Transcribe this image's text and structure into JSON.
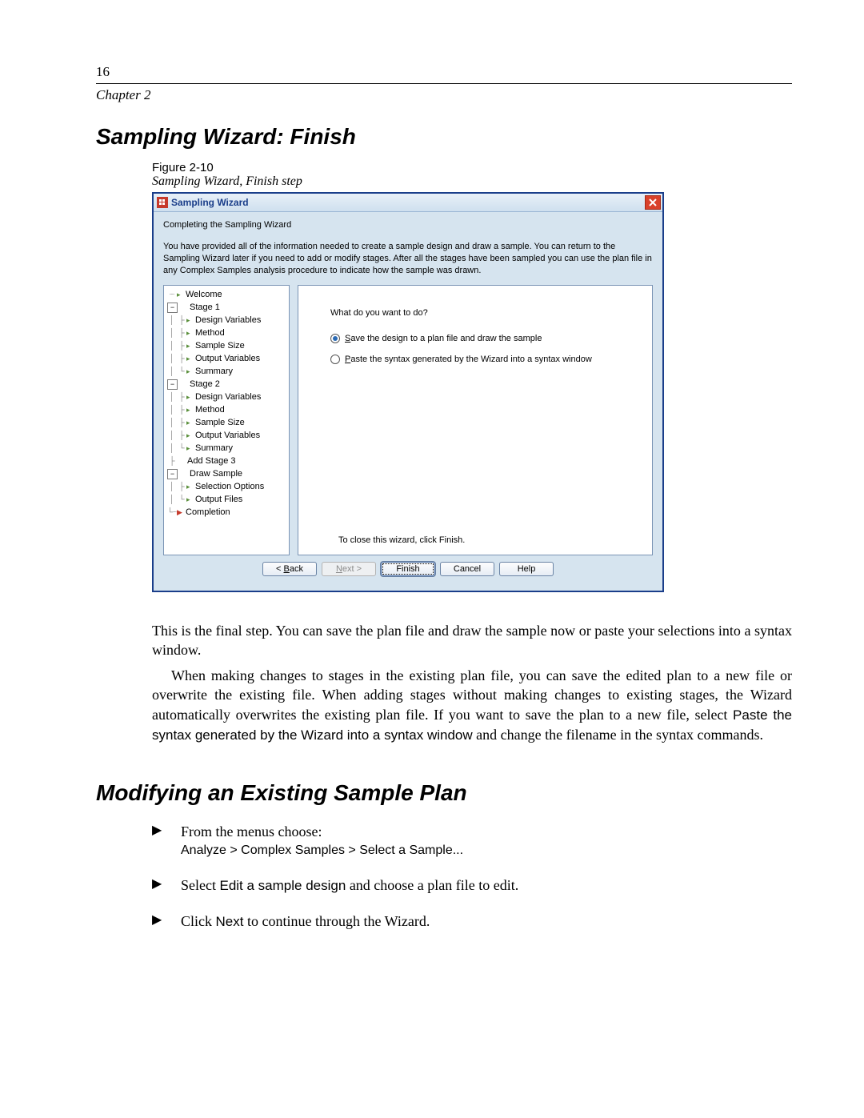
{
  "page": {
    "number": "16",
    "chapter": "Chapter 2"
  },
  "heading1": "Sampling Wizard: Finish",
  "figure": {
    "label": "Figure 2-10",
    "caption": "Sampling Wizard, Finish step"
  },
  "dialog": {
    "title": "Sampling Wizard",
    "subtitle": "Completing the Sampling Wizard",
    "desc": "You have provided all of the information needed to create a sample design and draw a sample.\nYou can return to the Sampling Wizard later if you need to add or modify stages. After all the stages have been sampled you can use the plan file in any Complex Samples analysis procedure to indicate how the sample was drawn.",
    "tree": {
      "welcome": "Welcome",
      "stage1": "Stage 1",
      "stage2": "Stage 2",
      "design_variables": "Design Variables",
      "method": "Method",
      "sample_size": "Sample Size",
      "output_variables": "Output Variables",
      "summary": "Summary",
      "add_stage3": "Add Stage 3",
      "draw_sample": "Draw Sample",
      "selection_options": "Selection Options",
      "output_files": "Output Files",
      "completion": "Completion"
    },
    "question": "What do you want to do?",
    "radio1_pre": "S",
    "radio1_rest": "ave the design to a plan file and draw the sample",
    "radio2_pre": "P",
    "radio2_rest": "aste the syntax generated by the Wizard into a syntax window",
    "footer_text": "To close this wizard, click Finish.",
    "buttons": {
      "back_pre": "< ",
      "back_u": "B",
      "back_rest": "ack",
      "next_u": "N",
      "next_rest": "ext >",
      "finish": "Finish",
      "cancel": "Cancel",
      "help": "Help"
    }
  },
  "para1_a": "This is the final step. You can save the plan file and draw the sample now or paste your selections into a syntax window.",
  "para2_a": "When making changes to stages in the existing plan file, you can save the edited plan to a new file or overwrite the existing file. When adding stages without making changes to existing stages, the Wizard automatically overwrites the existing plan file. If you want to save the plan to a new file, select ",
  "para2_sans": "Paste the syntax generated by the Wizard into a syntax window",
  "para2_b": " and change the filename in the syntax commands.",
  "heading2": "Modifying an Existing Sample Plan",
  "steps": {
    "s1_a": "From the menus choose:",
    "s1_path": "Analyze > Complex Samples > Select a Sample...",
    "s2_a": "Select ",
    "s2_sans": "Edit a sample design",
    "s2_b": " and choose a plan file to edit.",
    "s3_a": "Click ",
    "s3_sans": "Next",
    "s3_b": " to continue through the Wizard."
  }
}
